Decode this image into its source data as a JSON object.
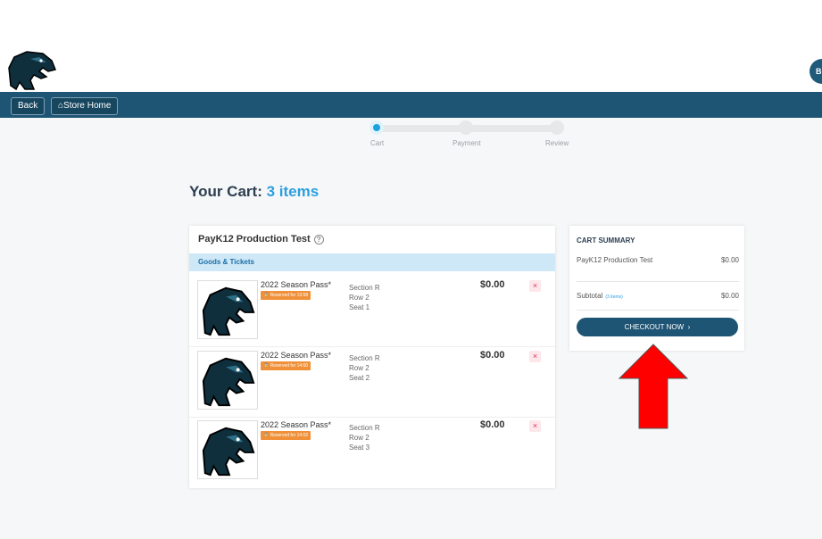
{
  "header": {
    "user_initials": "BI"
  },
  "nav": {
    "back_label": "Back",
    "store_home_label": "Store Home"
  },
  "steps": [
    {
      "label": "Cart",
      "active": true
    },
    {
      "label": "Payment",
      "active": false
    },
    {
      "label": "Review",
      "active": false
    }
  ],
  "cart": {
    "title": "Your Cart:",
    "count_label": "3 items",
    "store_name": "PayK12 Production Test",
    "section_label": "Goods & Tickets",
    "items": [
      {
        "name": "2022 Season Pass*",
        "reserved": "Reserved for 13:58",
        "section": "Section R",
        "row": "Row 2",
        "seat": "Seat 1",
        "price": "$0.00"
      },
      {
        "name": "2022 Season Pass*",
        "reserved": "Reserved for 14:00",
        "section": "Section R",
        "row": "Row 2",
        "seat": "Seat 2",
        "price": "$0.00"
      },
      {
        "name": "2022 Season Pass*",
        "reserved": "Reserved for 14:02",
        "section": "Section R",
        "row": "Row 2",
        "seat": "Seat 3",
        "price": "$0.00"
      }
    ]
  },
  "summary": {
    "title": "CART SUMMARY",
    "store_name": "PayK12 Production Test",
    "store_amount": "$0.00",
    "subtotal_label": "Subtotal",
    "subtotal_count": "(3 items)",
    "subtotal_amount": "$0.00",
    "checkout_label": "CHECKOUT NOW",
    "checkout_chevron": "›"
  },
  "colors": {
    "nav": "#1e5574",
    "accent": "#2b9fe0",
    "badge": "#f0913a",
    "arrow": "#ff0000"
  }
}
